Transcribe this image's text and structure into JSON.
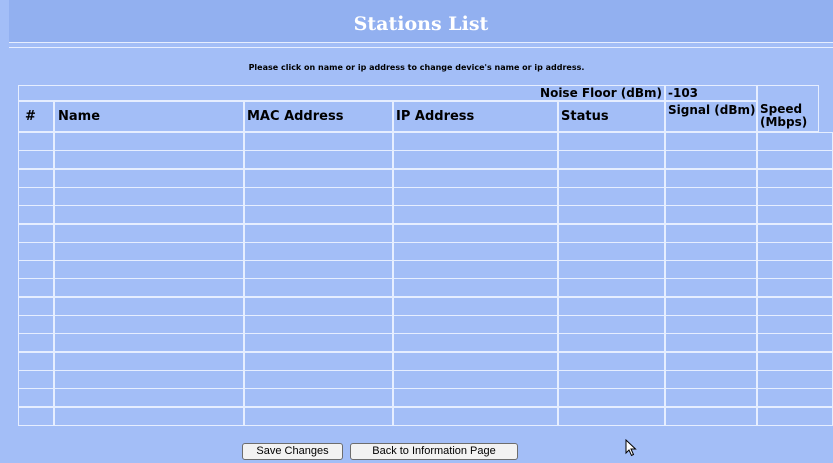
{
  "page_title": "Stations List",
  "instructions": "Please click on name or ip address to change device's name or ip address.",
  "noise_floor": {
    "label": "Noise Floor (dBm)",
    "value": "-103"
  },
  "columns": [
    "#",
    "Name",
    "MAC Address",
    "IP Address",
    "Status",
    "Signal (dBm)",
    "Speed (Mbps)"
  ],
  "rows": [
    [
      "",
      "",
      "",
      "",
      "",
      "",
      ""
    ],
    [
      "",
      "",
      "",
      "",
      "",
      "",
      ""
    ],
    [
      "",
      "",
      "",
      "",
      "",
      "",
      ""
    ],
    [
      "",
      "",
      "",
      "",
      "",
      "",
      ""
    ],
    [
      "",
      "",
      "",
      "",
      "",
      "",
      ""
    ],
    [
      "",
      "",
      "",
      "",
      "",
      "",
      ""
    ],
    [
      "",
      "",
      "",
      "",
      "",
      "",
      ""
    ],
    [
      "",
      "",
      "",
      "",
      "",
      "",
      ""
    ],
    [
      "",
      "",
      "",
      "",
      "",
      "",
      ""
    ],
    [
      "",
      "",
      "",
      "",
      "",
      "",
      ""
    ],
    [
      "",
      "",
      "",
      "",
      "",
      "",
      ""
    ],
    [
      "",
      "",
      "",
      "",
      "",
      "",
      ""
    ],
    [
      "",
      "",
      "",
      "",
      "",
      "",
      ""
    ],
    [
      "",
      "",
      "",
      "",
      "",
      "",
      ""
    ],
    [
      "",
      "",
      "",
      "",
      "",
      "",
      ""
    ],
    [
      "",
      "",
      "",
      "",
      "",
      "",
      ""
    ]
  ],
  "buttons": {
    "save": "Save Changes",
    "back": "Back to Information Page"
  },
  "cursor_icon": "mouse-pointer-icon",
  "colors": {
    "background": "#a3bef7",
    "header": "#92b0f0",
    "grid_lines": "#e6eeff"
  }
}
